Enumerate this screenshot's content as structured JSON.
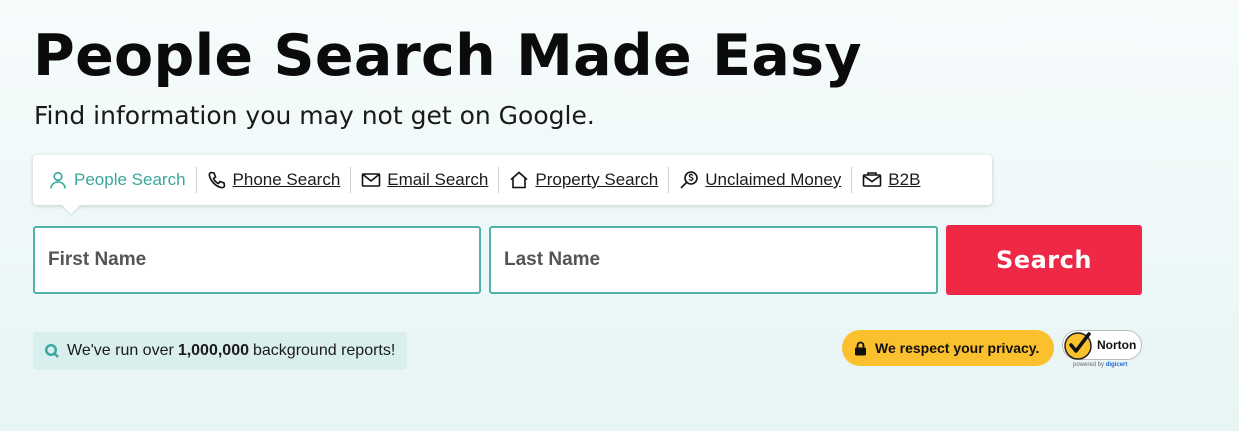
{
  "hero": {
    "title": "People Search Made Easy",
    "subtitle": "Find information you may not get on Google."
  },
  "tabs": [
    {
      "label": "People Search",
      "icon": "person-icon",
      "active": true
    },
    {
      "label": "Phone Search",
      "icon": "phone-icon",
      "active": false
    },
    {
      "label": "Email Search",
      "icon": "envelope-icon",
      "active": false
    },
    {
      "label": "Property Search",
      "icon": "house-icon",
      "active": false
    },
    {
      "label": "Unclaimed Money",
      "icon": "money-search-icon",
      "active": false
    },
    {
      "label": "B2B",
      "icon": "briefcase-mail-icon",
      "active": false
    }
  ],
  "form": {
    "first_name_placeholder": "First Name",
    "last_name_placeholder": "Last Name",
    "search_label": "Search"
  },
  "info": {
    "prefix": "We've run over",
    "count": "1,000,000",
    "suffix": "background reports!"
  },
  "privacy": {
    "label": "We respect your privacy."
  },
  "norton": {
    "label": "Norton",
    "powered_by": "powered by",
    "powered_brand": "digicert"
  },
  "colors": {
    "accent": "#3aa79c",
    "search_button": "#ef2846",
    "privacy_badge": "#fbc02d",
    "info_pill_bg": "#d8efee"
  }
}
